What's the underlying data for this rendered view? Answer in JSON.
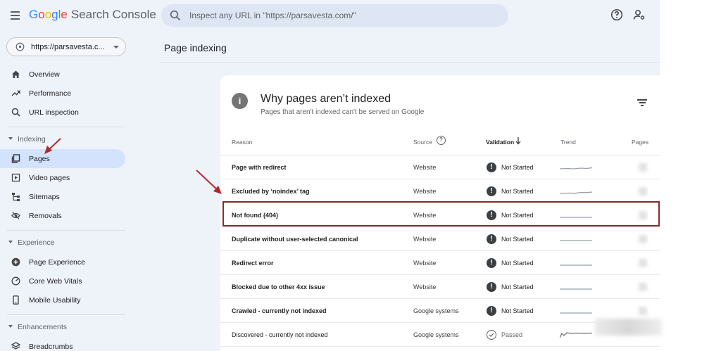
{
  "header": {
    "logo_word": "Google",
    "logo_product": "Search Console",
    "search_placeholder": "Inspect any URL in \"https://parsavesta.com/\""
  },
  "property": {
    "label": "https://parsavesta.c..."
  },
  "sidebar": {
    "top_items": [
      {
        "label": "Overview",
        "icon": "home-icon"
      },
      {
        "label": "Performance",
        "icon": "trending-up-icon"
      },
      {
        "label": "URL inspection",
        "icon": "search-icon"
      }
    ],
    "indexing": {
      "label": "Indexing",
      "items": [
        {
          "label": "Pages",
          "icon": "pages-icon",
          "active": true
        },
        {
          "label": "Video pages",
          "icon": "video-icon"
        },
        {
          "label": "Sitemaps",
          "icon": "sitemap-icon"
        },
        {
          "label": "Removals",
          "icon": "eye-off-icon"
        }
      ]
    },
    "experience": {
      "label": "Experience",
      "items": [
        {
          "label": "Page Experience",
          "icon": "plus-circle-icon"
        },
        {
          "label": "Core Web Vitals",
          "icon": "gauge-icon"
        },
        {
          "label": "Mobile Usability",
          "icon": "phone-icon"
        }
      ]
    },
    "enhancements": {
      "label": "Enhancements",
      "items": [
        {
          "label": "Breadcrumbs",
          "icon": "layers-icon"
        }
      ]
    }
  },
  "main": {
    "page_title": "Page indexing",
    "card": {
      "title": "Why pages aren’t indexed",
      "subtitle": "Pages that aren't indexed can't be served on Google",
      "columns": {
        "reason": "Reason",
        "source": "Source",
        "validation": "Validation",
        "trend": "Trend",
        "pages": "Pages"
      },
      "rows": [
        {
          "reason": "Page with redirect",
          "source": "Website",
          "validation": "Not Started"
        },
        {
          "reason": "Excluded by ‘noindex’ tag",
          "source": "Website",
          "validation": "Not Started"
        },
        {
          "reason": "Not found (404)",
          "source": "Website",
          "validation": "Not Started"
        },
        {
          "reason": "Duplicate without user-selected canonical",
          "source": "Website",
          "validation": "Not Started"
        },
        {
          "reason": "Redirect error",
          "source": "Website",
          "validation": "Not Started"
        },
        {
          "reason": "Blocked due to other 4xx issue",
          "source": "Website",
          "validation": "Not Started"
        },
        {
          "reason": "Crawled - currently not indexed",
          "source": "Google systems",
          "validation": "Not Started"
        },
        {
          "reason": "Discovered - currently not indexed",
          "source": "Google systems",
          "validation": "Passed"
        }
      ]
    }
  },
  "colors": {
    "app_bg": "#eef2f9",
    "active_nav": "#d3e3fd",
    "annotation": "#8b2b2b",
    "arrow": "#b02a2a"
  }
}
